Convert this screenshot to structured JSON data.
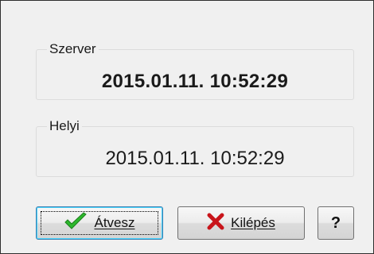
{
  "server": {
    "legend": "Szerver",
    "value": "2015.01.11.  10:52:29"
  },
  "local": {
    "legend": "Helyi",
    "value": "2015.01.11. 10:52:29"
  },
  "buttons": {
    "accept_label": "Átvesz",
    "quit_label": "Kilépés",
    "help_label": "?"
  },
  "colors": {
    "check": "#2db82d",
    "cross": "#c8141a"
  },
  "icons": {
    "accept": "check-icon",
    "quit": "x-icon"
  }
}
